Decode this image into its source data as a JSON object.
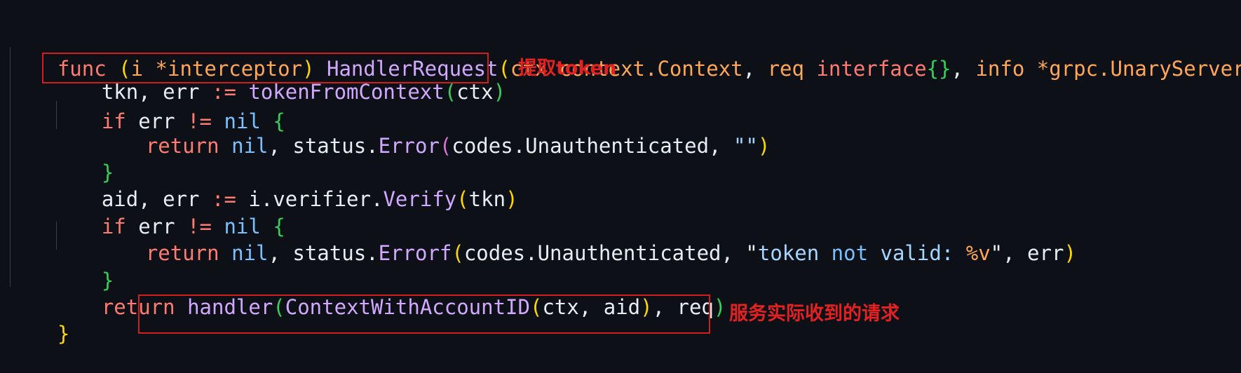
{
  "code": {
    "l1": {
      "kw_func": "func",
      "sp1": " ",
      "p_open": "(",
      "recv": "i *interceptor",
      "p_close": ")",
      "sp2": " ",
      "fname": "HandlerRequest",
      "a_open": "(",
      "ctx_name": "ctx",
      "sp3": " ",
      "ctx_type": "context.Context",
      "comma1": ", ",
      "req_name": "req",
      "sp4": " ",
      "iface": "interface",
      "braces": "{}",
      "comma2": ", ",
      "info_name": "info",
      "sp5": " ",
      "info_type": "*grpc.UnaryServerIn"
    },
    "l2": {
      "lhs": "tkn, err ",
      "op": ":=",
      "sp": " ",
      "fn": "tokenFromContext",
      "open": "(",
      "arg": "ctx",
      "close": ")"
    },
    "l3": {
      "kw": "if",
      "mid": " err ",
      "op": "!=",
      "sp": " ",
      "nil": "nil",
      "sp2": " ",
      "brace": "{"
    },
    "l4": {
      "kw": "return",
      "sp": " ",
      "nil": "nil",
      "comma": ", ",
      "pkg": "status.",
      "fn": "Error",
      "open": "(",
      "arg": "codes.Unauthenticated, ",
      "str": "\"\"",
      "close": ")"
    },
    "l5": {
      "brace": "}"
    },
    "l6": {
      "lhs": "aid, err ",
      "op": ":=",
      "sp": " ",
      "obj": "i.verifier.",
      "fn": "Verify",
      "open": "(",
      "arg": "tkn",
      "close": ")"
    },
    "l7": {
      "kw": "if",
      "mid": " err ",
      "op": "!=",
      "sp": " ",
      "nil": "nil",
      "sp2": " ",
      "brace": "{"
    },
    "l8": {
      "kw": "return",
      "sp": " ",
      "nil": "nil",
      "comma": ", ",
      "pkg": "status.",
      "fn": "Errorf",
      "open": "(",
      "arg": "codes.Unauthenticated, ",
      "q1": "\"",
      "s1": "token ",
      "not": "not",
      "s2": " valid: ",
      "fmt": "%v",
      "q2": "\"",
      "rest": ", err",
      "close": ")"
    },
    "l9": {
      "brace": "}"
    },
    "l10": {
      "kw": "return",
      "sp": " ",
      "fn": "handler",
      "open1": "(",
      "fn2": "ContextWithAccountID",
      "open2": "(",
      "args": "ctx, aid",
      "close2": ")",
      "rest": ", req",
      "close1": ")"
    },
    "l11": {
      "brace": "}"
    }
  },
  "annotations": {
    "token": "提取token",
    "request": "服务实际收到的请求"
  },
  "colors": {
    "background": "#0d1117",
    "keyword": "#ff7b72",
    "function": "#d2a8ff",
    "parameter": "#ffa657",
    "constant": "#79c0ff",
    "string": "#a5d6ff",
    "annotation_red": "#e32121"
  }
}
